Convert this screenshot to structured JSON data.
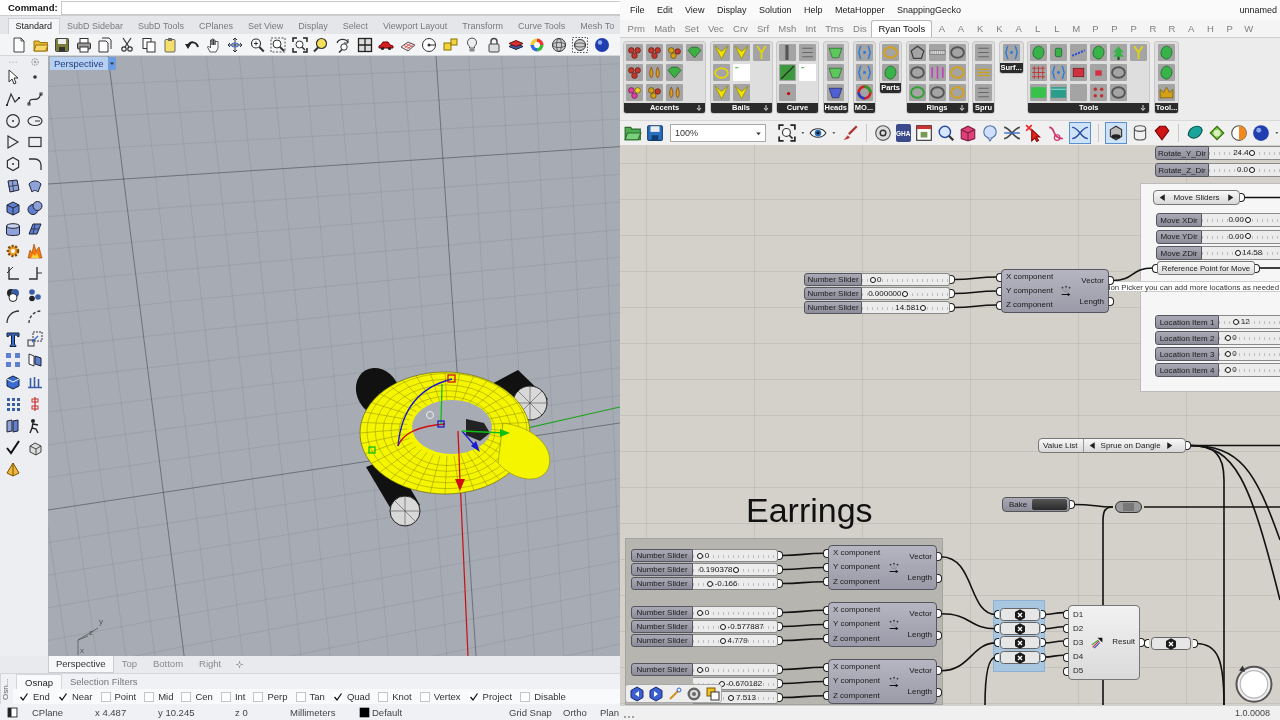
{
  "rhino": {
    "command": {
      "label": "Command:"
    },
    "toolbar_tabs": [
      {
        "label": "Standard",
        "selected": true
      },
      {
        "label": "SubD Sidebar",
        "selected": false
      },
      {
        "label": "SubD Tools",
        "selected": false
      },
      {
        "label": "CPlanes",
        "selected": false
      },
      {
        "label": "Set View",
        "selected": false
      },
      {
        "label": "Display",
        "selected": false
      },
      {
        "label": "Select",
        "selected": false
      },
      {
        "label": "Viewport Layout",
        "selected": false
      },
      {
        "label": "Transform",
        "selected": false
      },
      {
        "label": "Curve Tools",
        "selected": false
      },
      {
        "label": "Mesh To",
        "selected": false
      }
    ],
    "viewport": {
      "title": "Perspective",
      "axis_labels": [
        "y",
        "z",
        "x"
      ]
    },
    "viewport_tabs": [
      {
        "label": "Perspective",
        "selected": true
      },
      {
        "label": "Top",
        "selected": false
      },
      {
        "label": "Bottom",
        "selected": false
      },
      {
        "label": "Right",
        "selected": false
      }
    ],
    "panel": {
      "side_label": "Osn...",
      "tabs": [
        {
          "label": "Osnap",
          "selected": true
        },
        {
          "label": "Selection Filters",
          "selected": false
        }
      ],
      "osnaps": [
        {
          "label": "End",
          "checked": true
        },
        {
          "label": "Near",
          "checked": true
        },
        {
          "label": "Point",
          "checked": false
        },
        {
          "label": "Mid",
          "checked": false
        },
        {
          "label": "Cen",
          "checked": false
        },
        {
          "label": "Int",
          "checked": false
        },
        {
          "label": "Perp",
          "checked": false
        },
        {
          "label": "Tan",
          "checked": false
        },
        {
          "label": "Quad",
          "checked": true
        },
        {
          "label": "Knot",
          "checked": false
        },
        {
          "label": "Vertex",
          "checked": false
        },
        {
          "label": "Project",
          "checked": true
        },
        {
          "label": "Disable",
          "checked": false
        }
      ]
    },
    "status_bar": {
      "cplane": "CPlane",
      "x": "x 4.487",
      "y": "y 10.245",
      "z": "z 0",
      "units": "Millimeters",
      "layer": "Default",
      "toggles": [
        "Grid Snap",
        "Ortho",
        "Plan"
      ]
    }
  },
  "grasshopper": {
    "menu": [
      "File",
      "Edit",
      "View",
      "Display",
      "Solution",
      "Help",
      "MetaHopper",
      "SnappingGecko"
    ],
    "document_name": "unnamed",
    "tabs": [
      {
        "label": "Prm",
        "selected": false
      },
      {
        "label": "Math",
        "selected": false
      },
      {
        "label": "Set",
        "selected": false
      },
      {
        "label": "Vec",
        "selected": false
      },
      {
        "label": "Crv",
        "selected": false
      },
      {
        "label": "Srf",
        "selected": false
      },
      {
        "label": "Msh",
        "selected": false
      },
      {
        "label": "Int",
        "selected": false
      },
      {
        "label": "Trns",
        "selected": false
      },
      {
        "label": "Dis",
        "selected": false
      },
      {
        "label": "Ryan Tools",
        "selected": true
      },
      {
        "label": "A",
        "selected": false
      },
      {
        "label": "A",
        "selected": false
      },
      {
        "label": "K",
        "selected": false
      },
      {
        "label": "K",
        "selected": false
      },
      {
        "label": "A",
        "selected": false
      },
      {
        "label": "L",
        "selected": false
      },
      {
        "label": "L",
        "selected": false
      },
      {
        "label": "M",
        "selected": false
      },
      {
        "label": "P",
        "selected": false
      },
      {
        "label": "P",
        "selected": false
      },
      {
        "label": "P",
        "selected": false
      },
      {
        "label": "R",
        "selected": false
      },
      {
        "label": "R",
        "selected": false
      },
      {
        "label": "A",
        "selected": false
      },
      {
        "label": "H",
        "selected": false
      },
      {
        "label": "P",
        "selected": false
      },
      {
        "label": "W",
        "selected": false
      }
    ],
    "ribbon_panels": [
      {
        "label": "Accents",
        "dropdown": true
      },
      {
        "label": "Bails",
        "dropdown": true
      },
      {
        "label": "Curve",
        "dropdown": false
      },
      {
        "label": "Heads",
        "dropdown": false
      },
      {
        "label": "MO...",
        "dropdown": false
      },
      {
        "label": "Parts",
        "dropdown": false
      },
      {
        "label": "Rings",
        "dropdown": true
      },
      {
        "label": "Spru",
        "dropdown": false
      },
      {
        "label": "Surf...",
        "dropdown": false
      },
      {
        "label": "Tools",
        "dropdown": true
      },
      {
        "label": "Tool...",
        "dropdown": false
      }
    ],
    "canvas_toolbar": {
      "zoom": "100%",
      "package_label": "GHA",
      "toggle_states": [
        {
          "on": true
        },
        {
          "on": true
        }
      ]
    },
    "canvas": {
      "rotate_sliders": [
        {
          "label": "Rotate_Y_Dir",
          "value": "24.4",
          "level": 0.63
        },
        {
          "label": "Rotate_Z_Dir",
          "value": "0.0",
          "level": 0.62
        }
      ],
      "control_group": {
        "value_list": {
          "value": "Move Sliders"
        },
        "sliders": [
          {
            "label": "Move XDir",
            "value": "0.00",
            "level": 0.6
          },
          {
            "label": "Move YDir",
            "value": "0.00",
            "level": 0.6
          },
          {
            "label": "Move ZDir",
            "value": "14.58",
            "level": 0.46
          }
        ],
        "parameter": "Reference Point for Move",
        "location_sliders": [
          {
            "label": "Location Item 1",
            "value": "12",
            "level": 0.26
          },
          {
            "label": "Location Item 2",
            "value": "0",
            "level": 0.1
          },
          {
            "label": "Location Item 3",
            "value": "0",
            "level": 0.1
          },
          {
            "label": "Location Item 4",
            "value": "0",
            "level": 0.1
          }
        ]
      },
      "hint": "ion Picker you can add more locations as needed",
      "vector_block": {
        "sliders": [
          {
            "label": "Number Slider",
            "value": "0",
            "level": 0.09
          },
          {
            "label": "Number Slider",
            "value": "0.000000",
            "level": 0.5
          },
          {
            "label": "Number Slider",
            "value": "14.581",
            "level": 0.73
          }
        ],
        "component": {
          "inputs": [
            "X component",
            "Y component",
            "Z component"
          ],
          "outputs": [
            "Vector",
            "Length"
          ]
        }
      },
      "value_list": {
        "label": "Value List",
        "value": "Sprue on Dangle"
      },
      "bake_button": {
        "label": "Bake"
      },
      "title": "Earrings",
      "earring_group": [
        {
          "sliders": [
            {
              "label": "Number Slider",
              "value": "0",
              "level": 0.05
            },
            {
              "label": "Number Slider",
              "value": "0.190378",
              "level": 0.52
            },
            {
              "label": "Number Slider",
              "value": "-0.166",
              "level": 0.18
            }
          ],
          "component": {
            "inputs": [
              "X component",
              "Y component",
              "Z component"
            ],
            "outputs": [
              "Vector",
              "Length"
            ]
          }
        },
        {
          "sliders": [
            {
              "label": "Number Slider",
              "value": "0",
              "level": 0.05
            },
            {
              "label": "Number Slider",
              "value": "-0.577887",
              "level": 0.35
            },
            {
              "label": "Number Slider",
              "value": "4.779",
              "level": 0.35
            }
          ],
          "component": {
            "inputs": [
              "X component",
              "Y component",
              "Z component"
            ],
            "outputs": [
              "Vector",
              "Length"
            ]
          }
        },
        {
          "sliders": [
            {
              "label": "Number Slider",
              "value": "0",
              "level": 0.05
            },
            {
              "value": "-0.670182",
              "level": 0.33
            },
            {
              "value": "7.513",
              "level": 0.46
            }
          ],
          "component": {
            "inputs": [
              "X component",
              "Y component",
              "Z component"
            ],
            "outputs": [
              "Vector",
              "Length"
            ]
          }
        }
      ],
      "merge": {
        "inputs": [
          "D1",
          "D2",
          "D3",
          "D4",
          "D5"
        ],
        "output": "Result"
      }
    },
    "status_bar": {
      "version": "1.0.0008"
    }
  }
}
